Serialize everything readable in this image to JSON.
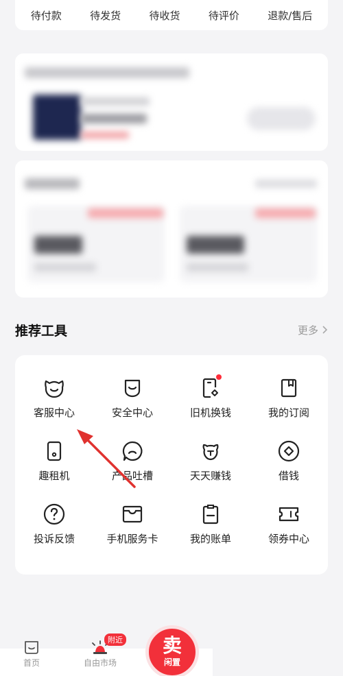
{
  "order_tabs": [
    "待付款",
    "待发货",
    "待收货",
    "待评价",
    "退款/售后"
  ],
  "tools": {
    "title": "推荐工具",
    "more": "更多",
    "items": [
      {
        "label": "客服中心",
        "icon": "customer-service-icon"
      },
      {
        "label": "安全中心",
        "icon": "shield-icon"
      },
      {
        "label": "旧机换钱",
        "icon": "trade-in-icon"
      },
      {
        "label": "我的订阅",
        "icon": "bookmark-icon"
      },
      {
        "label": "趣租机",
        "icon": "rent-phone-icon"
      },
      {
        "label": "产品吐槽",
        "icon": "feedback-face-icon"
      },
      {
        "label": "天天赚钱",
        "icon": "earn-money-icon"
      },
      {
        "label": "借钱",
        "icon": "loan-icon"
      },
      {
        "label": "投诉反馈",
        "icon": "question-icon"
      },
      {
        "label": "手机服务卡",
        "icon": "service-card-icon"
      },
      {
        "label": "我的账单",
        "icon": "bill-icon"
      },
      {
        "label": "领券中心",
        "icon": "coupon-icon"
      }
    ]
  },
  "bottom_nav": {
    "home": "首页",
    "market": "自由市场",
    "market_badge": "附近",
    "sell_main": "卖",
    "sell_sub": "闲置"
  },
  "colors": {
    "accent": "#f2303a",
    "arrow": "#e0322f"
  }
}
